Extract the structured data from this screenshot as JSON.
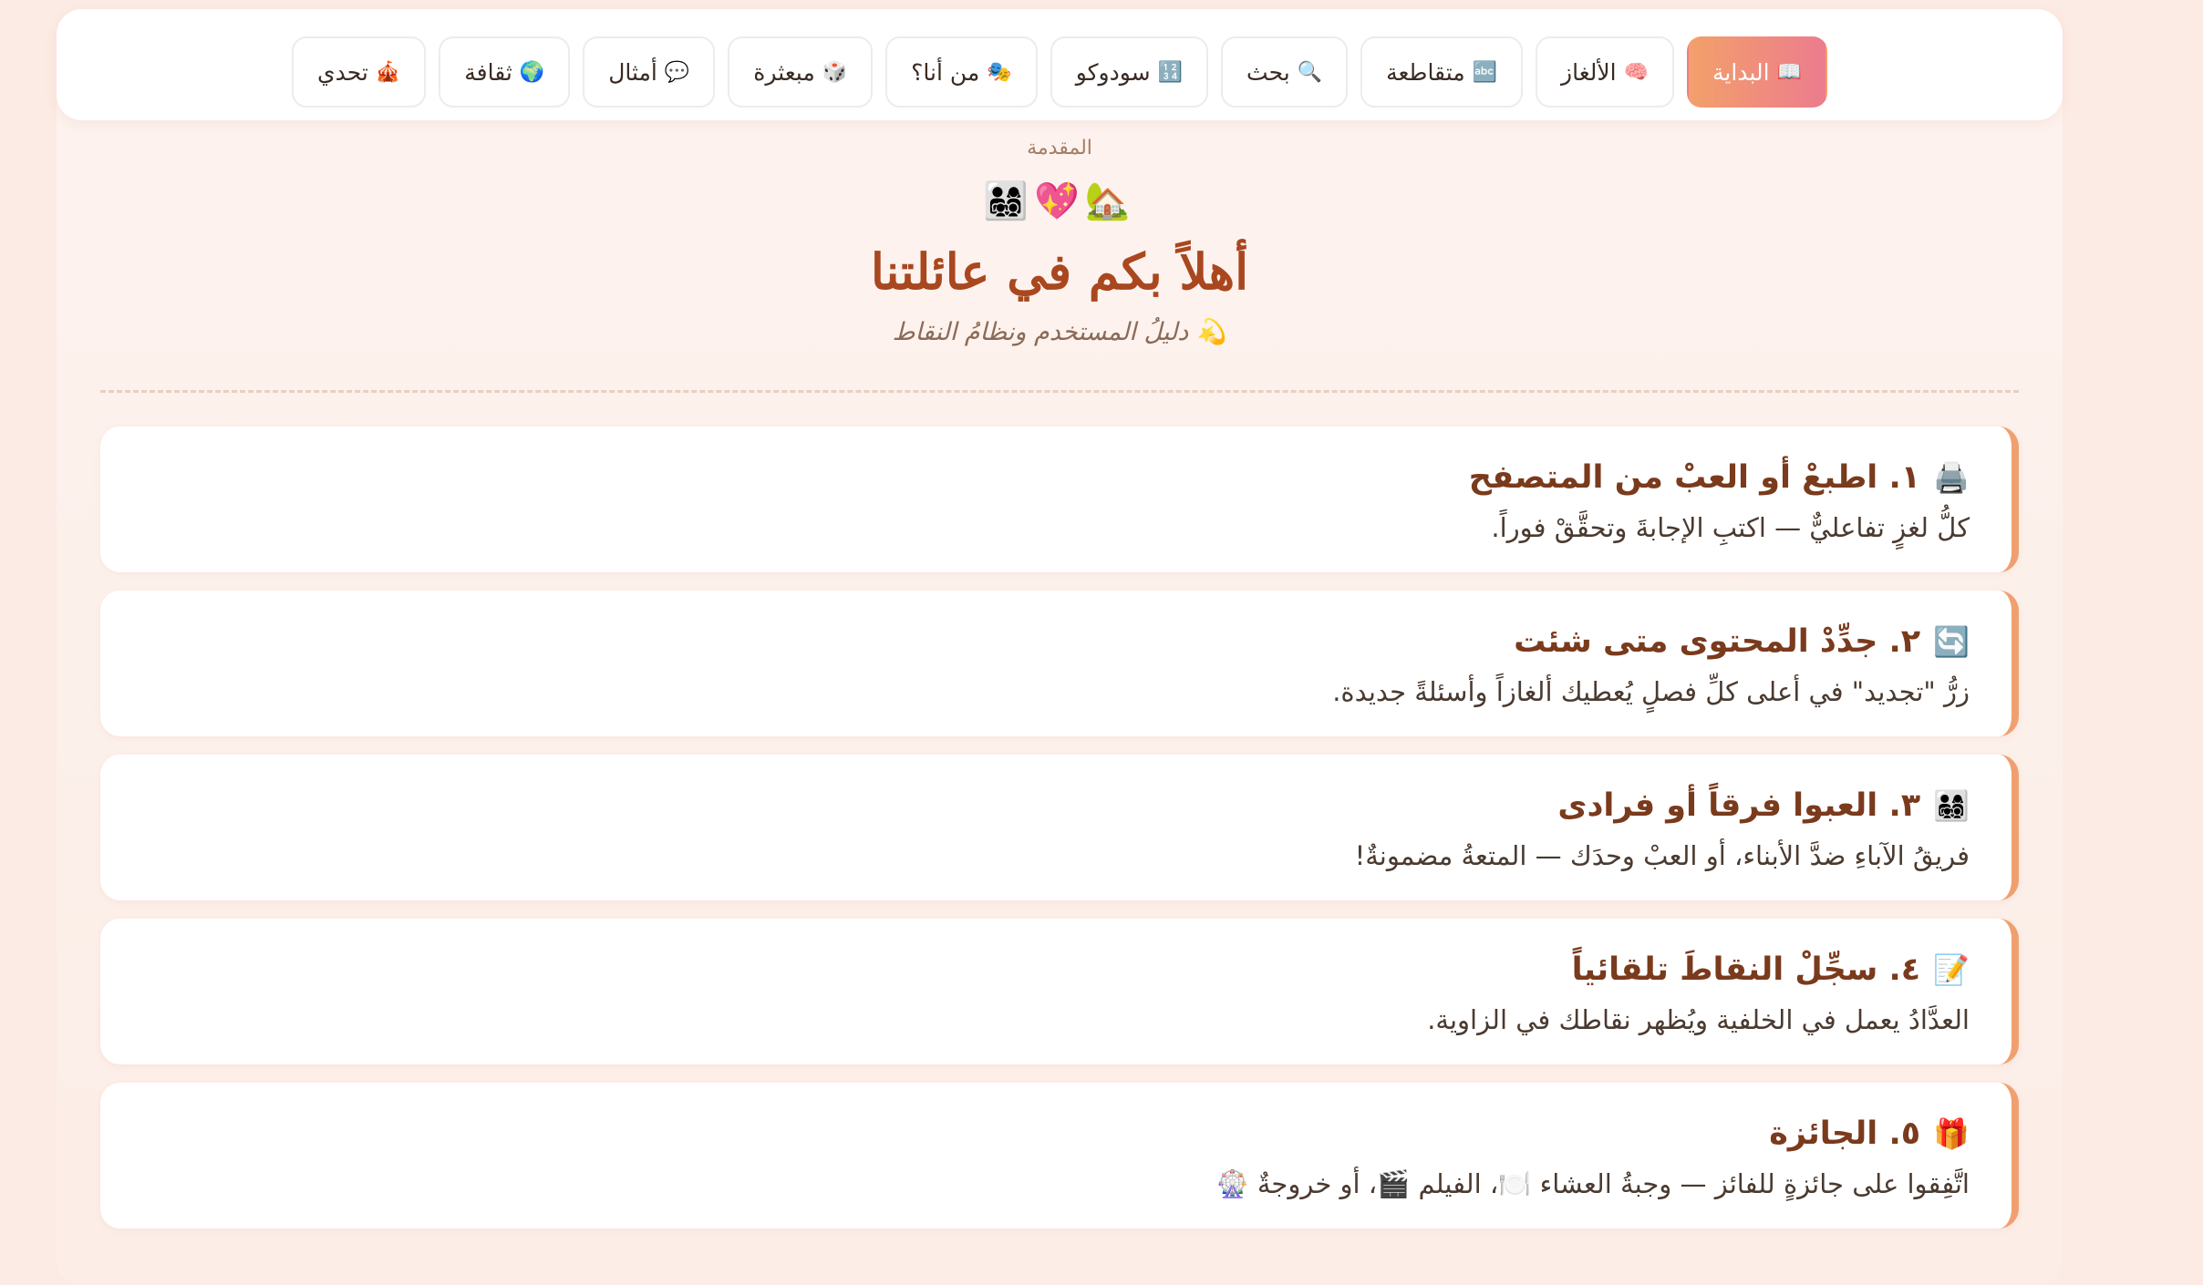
{
  "nav": {
    "items": [
      {
        "icon": "📖",
        "label": "البداية",
        "active": true
      },
      {
        "icon": "🧠",
        "label": "الألغاز"
      },
      {
        "icon": "🔤",
        "label": "متقاطعة"
      },
      {
        "icon": "🔍",
        "label": "بحث"
      },
      {
        "icon": "🔢",
        "label": "سودوكو"
      },
      {
        "icon": "🎭",
        "label": "من أنا؟"
      },
      {
        "icon": "🎲",
        "label": "مبعثرة"
      },
      {
        "icon": "💬",
        "label": "أمثال"
      },
      {
        "icon": "🌍",
        "label": "ثقافة"
      },
      {
        "icon": "🎪",
        "label": "تحدي"
      }
    ]
  },
  "header": {
    "kicker": "المقدمة",
    "emojis": "🏡💖👨‍👩‍👧‍👦",
    "title": "أهلاً بكم في عائلتنا",
    "subtitle": "💫 دليلُ المستخدم ونظامُ النقاط"
  },
  "steps": [
    {
      "icon": "🖨️",
      "title": "١. اطبعْ أو العبْ من المتصفح",
      "body": "كلُّ لغزٍ تفاعليٌّ — اكتبِ الإجابةَ وتحقَّقْ فوراً."
    },
    {
      "icon": "🔄",
      "title": "٢. جدِّدْ المحتوى متى شئت",
      "body": "زرُّ \"تجديد\" في أعلى كلِّ فصلٍ يُعطيك ألغازاً وأسئلةً جديدة."
    },
    {
      "icon": "👨‍👩‍👧‍👦",
      "title": "٣. العبوا فرقاً أو فرادى",
      "body": "فريقُ الآباءِ ضدَّ الأبناء، أو العبْ وحدَك — المتعةُ مضمونةٌ!"
    },
    {
      "icon": "📝",
      "title": "٤. سجِّلْ النقاطَ تلقائياً",
      "body": "العدَّادُ يعمل في الخلفية ويُظهر نقاطك في الزاوية."
    },
    {
      "icon": "🎁",
      "title": "٥. الجائزة",
      "body": "اتَّفِقوا على جائزةٍ للفائز — وجبةُ العشاء 🍽️، الفيلم 🎬، أو خروجةٌ 🎡"
    }
  ],
  "colors": {
    "background": "#fcebe4",
    "accent_gradient_start": "#f3a06a",
    "accent_gradient_end": "#ec7c8e",
    "title_color": "#a9471f",
    "card_border": "#f0a070"
  }
}
